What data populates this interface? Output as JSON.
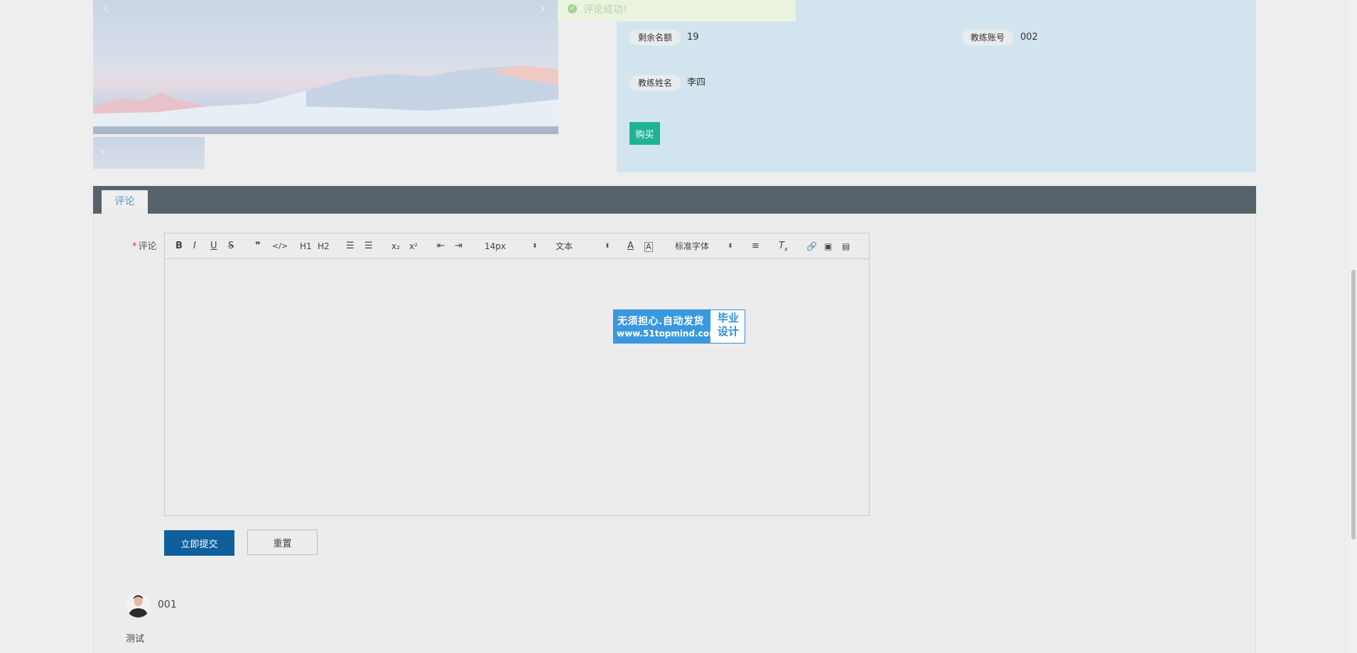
{
  "toast": {
    "message": "评论成功!"
  },
  "info": {
    "remaining_label": "剩余名额",
    "remaining_value": "19",
    "coach_account_label": "教练账号",
    "coach_account_value": "002",
    "coach_name_label": "教练姓名",
    "coach_name_value": "李四",
    "buy_label": "购买"
  },
  "tabs": [
    {
      "label": "评论"
    }
  ],
  "form": {
    "required_mark": "*",
    "comment_label": "评论",
    "submit_label": "立即提交",
    "reset_label": "重置"
  },
  "toolbar": {
    "font_size": "14px",
    "block_format": "文本",
    "font_family": "标准字体",
    "h1": "H1",
    "h2": "H2"
  },
  "watermark": {
    "line1": "无须担心.自动发货",
    "line2": "www.51topmind.com",
    "right_line1": "毕业",
    "right_line2": "设计"
  },
  "comments": [
    {
      "user": "001",
      "text": "测试"
    }
  ],
  "colors": {
    "info_bg": "#d2e5ee",
    "buy_button": "#1fb394",
    "tab_bar": "#58626b",
    "tab_active_text": "#4d9fd6",
    "submit_button": "#0e5f9c",
    "watermark_blue": "#3a98de"
  }
}
